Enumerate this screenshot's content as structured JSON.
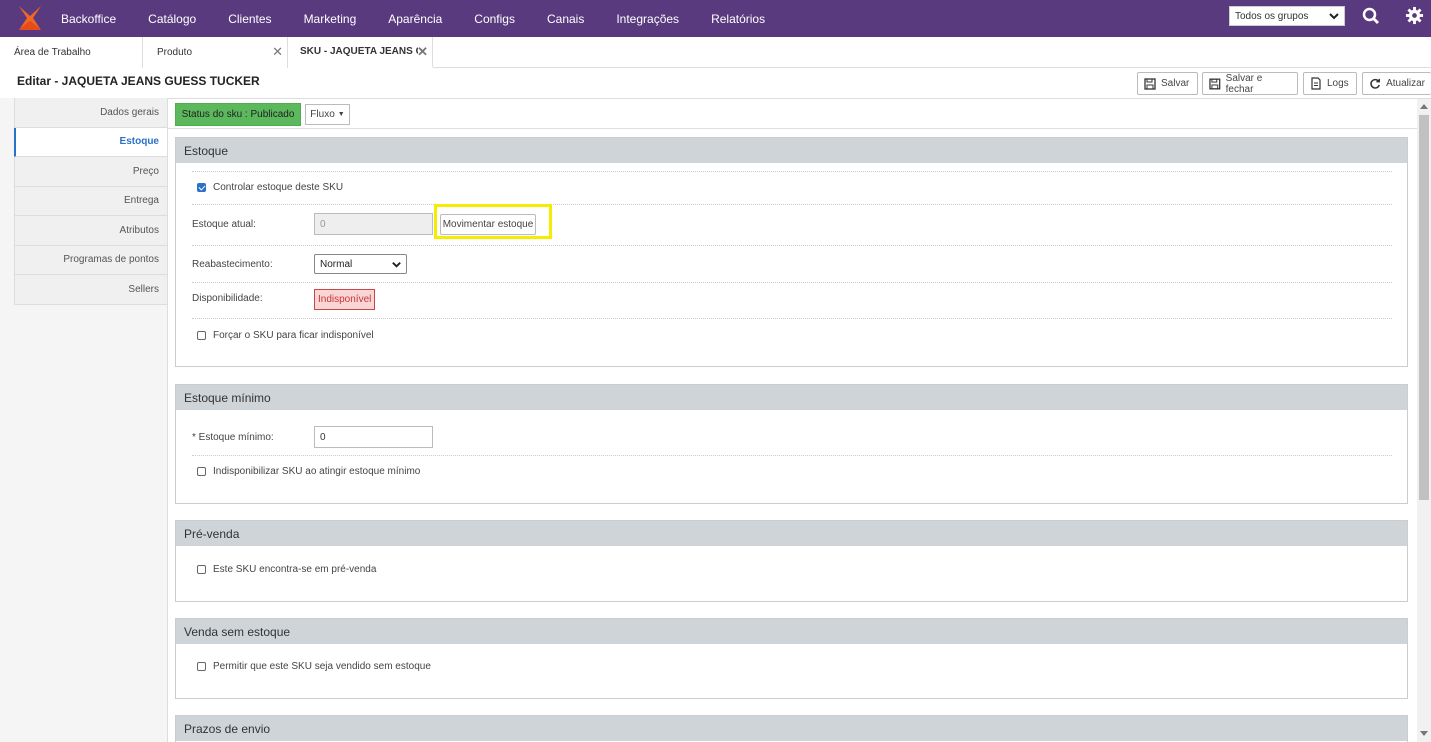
{
  "topbar": {
    "nav": [
      "Backoffice",
      "Catálogo",
      "Clientes",
      "Marketing",
      "Aparência",
      "Configs",
      "Canais",
      "Integrações",
      "Relatórios"
    ],
    "group_select": "Todos os grupos",
    "colors": {
      "bg": "#5a3a7e",
      "logo_orange": "#f26522"
    }
  },
  "tabs": [
    {
      "label": "Área de Trabalho"
    },
    {
      "label": "Produto"
    },
    {
      "label": "SKU - JAQUETA JEANS G"
    }
  ],
  "header": {
    "title": "Editar - JAQUETA JEANS GUESS TUCKER",
    "buttons": {
      "save": "Salvar",
      "save_close": "Salvar e fechar",
      "logs": "Logs",
      "refresh": "Atualizar"
    }
  },
  "sidebar": {
    "items": [
      "Dados gerais",
      "Estoque",
      "Preço",
      "Entrega",
      "Atributos",
      "Programas de pontos",
      "Sellers"
    ],
    "active": "Estoque"
  },
  "status": {
    "label": "Status do sku : Publicado",
    "fluxo": "Fluxo"
  },
  "estoque": {
    "title": "Estoque",
    "controlar": "Controlar estoque deste SKU",
    "atual_label": "Estoque atual:",
    "atual_value": "0",
    "movimentar": "Movimentar estoque",
    "reab_label": "Reabastecimento:",
    "reab_value": "Normal",
    "disp_label": "Disponibilidade:",
    "disp_value": "Indisponível",
    "forcar": "Forçar o SKU para ficar indisponível"
  },
  "estoque_minimo": {
    "title": "Estoque mínimo",
    "label": "* Estoque mínimo:",
    "value": "0",
    "indisp": "Indisponibilizar SKU ao atingir estoque mínimo"
  },
  "prevenda": {
    "title": "Pré-venda",
    "label": "Este SKU encontra-se em pré-venda"
  },
  "venda_sem": {
    "title": "Venda sem estoque",
    "label": "Permitir que este SKU seja vendido sem estoque"
  },
  "prazos": {
    "title": "Prazos de envio"
  }
}
